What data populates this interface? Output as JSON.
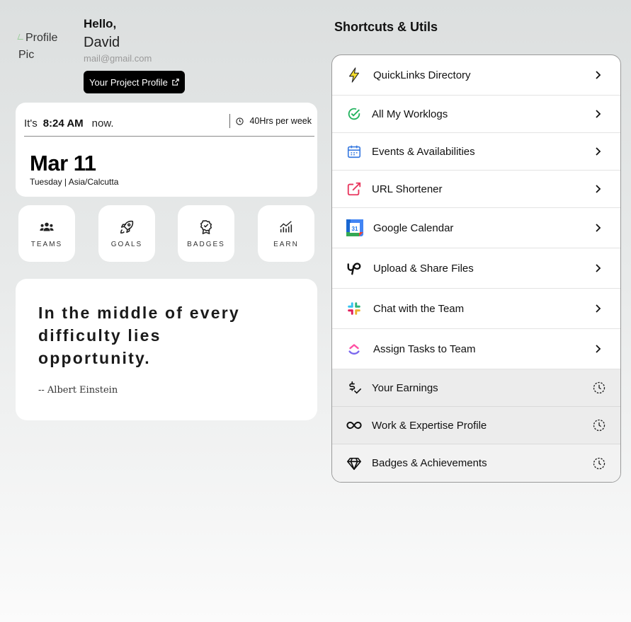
{
  "profile": {
    "pic_alt": "Profile Pic",
    "hello": "Hello,",
    "name": "David",
    "email": "mail@gmail.com",
    "project_button": "Your Project Profile"
  },
  "time": {
    "prefix": "It's",
    "clock": "8:24 AM",
    "suffix": "now.",
    "hours": "40Hrs per week",
    "date": "Mar 11",
    "day_tz": "Tuesday | Asia/Calcutta"
  },
  "tiles": [
    {
      "label": "TEAMS",
      "icon": "teams-icon"
    },
    {
      "label": "GOALS",
      "icon": "rocket-icon"
    },
    {
      "label": "BADGES",
      "icon": "badge-icon"
    },
    {
      "label": "EARN",
      "icon": "chart-icon"
    }
  ],
  "quote": {
    "text": "In the middle of every difficulty lies opportunity.",
    "author": "-- Albert Einstein"
  },
  "shortcuts": {
    "title": "Shortcuts & Utils",
    "items": [
      {
        "label": "QuickLinks Directory",
        "icon": "lightning-icon",
        "status": "available"
      },
      {
        "label": "All My Worklogs",
        "icon": "check-circle-icon",
        "status": "available"
      },
      {
        "label": "Events & Availabilities",
        "icon": "calendar-icon",
        "status": "available"
      },
      {
        "label": "URL Shortener",
        "icon": "external-link-icon",
        "status": "available"
      },
      {
        "label": "Google Calendar",
        "icon": "google-calendar-icon",
        "status": "available"
      },
      {
        "label": "Upload & Share Files",
        "icon": "upwork-icon",
        "status": "available"
      },
      {
        "label": "Chat with the Team",
        "icon": "slack-icon",
        "status": "available"
      },
      {
        "label": "Assign Tasks to Team",
        "icon": "clickup-icon",
        "status": "available"
      },
      {
        "label": "Your Earnings",
        "icon": "money-check-icon",
        "status": "coming-soon"
      },
      {
        "label": "Work & Expertise Profile",
        "icon": "infinity-icon",
        "status": "coming-soon"
      },
      {
        "label": "Badges & Achievements",
        "icon": "diamond-icon",
        "status": "coming-soon"
      }
    ]
  },
  "colors": {
    "accent_dark": "#000000",
    "card_bg": "#ffffff",
    "page_bg_top": "#dcdfdf"
  }
}
